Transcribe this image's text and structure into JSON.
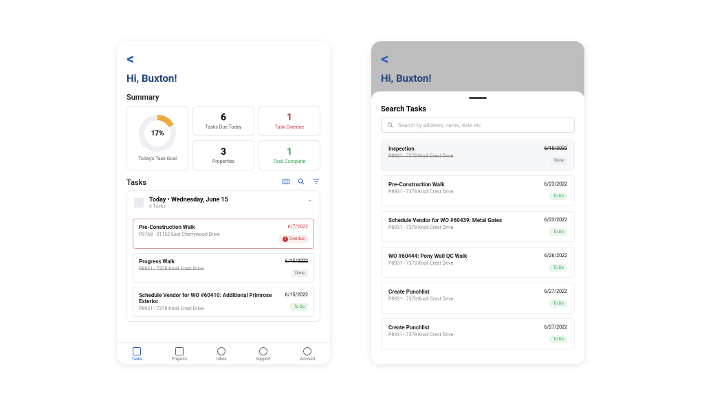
{
  "greeting": "Hi, Buxton!",
  "phoneA": {
    "summaryLabel": "Summary",
    "goal": {
      "percent": "17%",
      "label": "Today's Task Goal"
    },
    "cards": [
      {
        "num": "6",
        "label": "Tasks Due Today"
      },
      {
        "num": "1",
        "label": "Task Overdue",
        "cls": "red"
      },
      {
        "num": "3",
        "label": "Properties"
      },
      {
        "num": "1",
        "label": "Task Complete",
        "cls": "green"
      }
    ],
    "tasksLabel": "Tasks",
    "group": {
      "title": "Today • Wednesday, June 15",
      "sub": "6 Tasks"
    },
    "tasks": [
      {
        "title": "Pre-Construction Walk",
        "sub": "P9768 - 21152 East Cherrywood Drive",
        "date": "6/7/2022",
        "badge": "Overdue",
        "badgeCls": "b-overdue",
        "dateCls": "red",
        "overdue": true
      },
      {
        "title": "Progress Walk",
        "sub": "P8931 - 7378 Knoll Crest Drive",
        "date": "6/15/2022",
        "badge": "Done",
        "badgeCls": "b-done",
        "strike": true
      },
      {
        "title": "Schedule Vendor for WO #60410: Additional Primrose Exterior",
        "sub": "P8931 - 7378 Knoll Crest Drive",
        "date": "6/15/2022",
        "badge": "To Do",
        "badgeCls": "b-todo"
      }
    ],
    "nav": [
      {
        "label": "Tasks",
        "active": true
      },
      {
        "label": "Projects"
      },
      {
        "label": "Inbox"
      },
      {
        "label": "Support"
      },
      {
        "label": "Account"
      }
    ]
  },
  "phoneB": {
    "sheetTitle": "Search Tasks",
    "placeholder": "Search by address, name, date etc",
    "results": [
      {
        "title": "Inspection",
        "sub": "P8931 - 7378 Knoll Crest Drive",
        "date": "6/15/2022",
        "badge": "Done",
        "badgeCls": "b-done",
        "strike": true,
        "first": true
      },
      {
        "title": "Pre-Construction Walk",
        "sub": "P8931 - 7378 Knoll Crest Drive",
        "date": "6/23/2022",
        "badge": "To Do",
        "badgeCls": "b-todo"
      },
      {
        "title": "Schedule Vendor for WO #60439: Metal Gates",
        "sub": "P8931 - 7378 Knoll Crest Drive",
        "date": "6/23/2022",
        "badge": "To Do",
        "badgeCls": "b-todo"
      },
      {
        "title": "WO #60444: Pony Wall QC Walk",
        "sub": "P8931 - 7378 Knoll Crest Drive",
        "date": "6/26/2022",
        "badge": "To Do",
        "badgeCls": "b-todo"
      },
      {
        "title": "Create Punchlist",
        "sub": "P8931 - 7378 Knoll Crest Drive",
        "date": "6/27/2022",
        "badge": "To Do",
        "badgeCls": "b-todo"
      },
      {
        "title": "Create Punchlist",
        "sub": "P8931 - 7378 Knoll Crest Drive",
        "date": "6/27/2022",
        "badge": "To Do",
        "badgeCls": "b-todo"
      }
    ]
  }
}
